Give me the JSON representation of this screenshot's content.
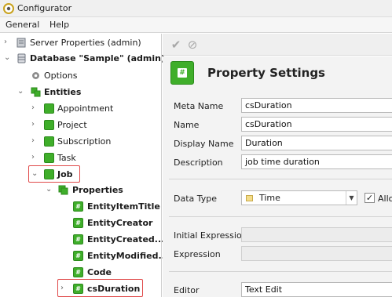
{
  "window": {
    "title": "Configurator"
  },
  "menu": {
    "items": [
      "General",
      "Help"
    ]
  },
  "tree": {
    "nodes": [
      {
        "label": "Server Properties (admin)",
        "icon": "server-icon"
      },
      {
        "label": "Database \"Sample\" (admin)",
        "icon": "database-icon"
      },
      {
        "label": "Options",
        "icon": "gear-icon"
      },
      {
        "label": "Entities",
        "icon": "entities-icon"
      },
      {
        "label": "Appointment",
        "icon": "entity-icon"
      },
      {
        "label": "Project",
        "icon": "entity-icon"
      },
      {
        "label": "Subscription",
        "icon": "entity-icon"
      },
      {
        "label": "Task",
        "icon": "entity-icon"
      },
      {
        "label": "Job",
        "icon": "entity-icon"
      },
      {
        "label": "Properties",
        "icon": "properties-icon"
      },
      {
        "label": "EntityItemTitle",
        "icon": "property-icon"
      },
      {
        "label": "EntityCreator",
        "icon": "property-icon"
      },
      {
        "label": "EntityCreated...",
        "icon": "property-icon"
      },
      {
        "label": "EntityModified...",
        "icon": "property-icon"
      },
      {
        "label": "Code",
        "icon": "property-icon"
      },
      {
        "label": "csDuration",
        "icon": "property-icon"
      }
    ]
  },
  "toolbar": {
    "buttons": [
      "check-icon",
      "cancel-icon"
    ]
  },
  "panel": {
    "title": "Property Settings",
    "fields": {
      "meta_name": {
        "label": "Meta Name",
        "value": "csDuration"
      },
      "name": {
        "label": "Name",
        "value": "csDuration"
      },
      "display_name": {
        "label": "Display Name",
        "value": "Duration"
      },
      "description": {
        "label": "Description",
        "value": "job time duration"
      },
      "data_type": {
        "label": "Data Type",
        "value": "Time",
        "checkbox_label": "Allo"
      },
      "initial_expression": {
        "label": "Initial Expression",
        "value": ""
      },
      "expression": {
        "label": "Expression",
        "value": ""
      },
      "editor": {
        "label": "Editor",
        "value": "Text Edit"
      }
    }
  },
  "colors": {
    "accent_green": "#3fae2a",
    "highlight_red": "#e04a4a"
  }
}
